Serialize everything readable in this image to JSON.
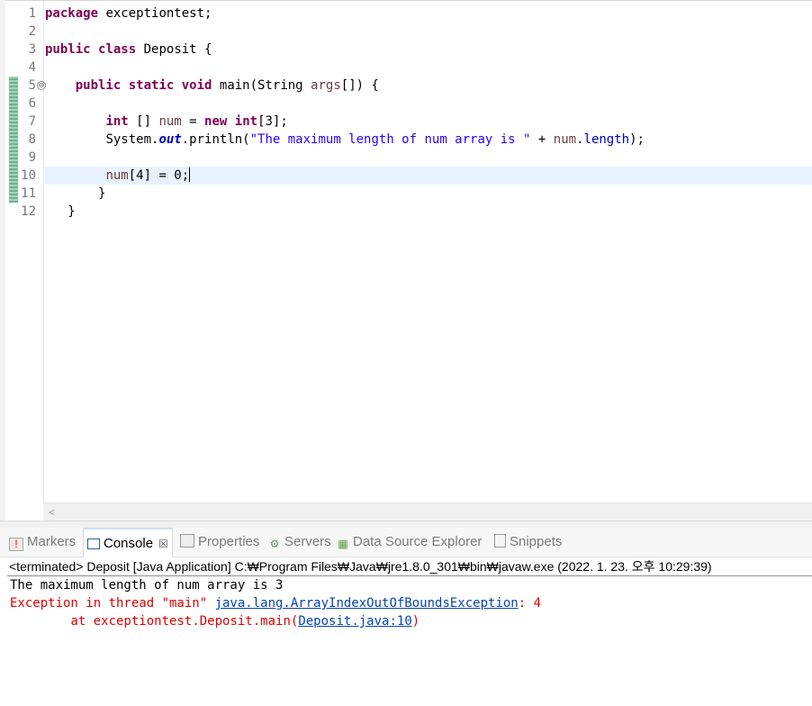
{
  "editor": {
    "line_numbers": [
      "1",
      "2",
      "3",
      "4",
      "5",
      "6",
      "7",
      "8",
      "9",
      "10",
      "11",
      "12"
    ],
    "fold_marker": "⊖",
    "scroll_left": "<",
    "code": {
      "l1_kw": "package",
      "l1_rest": " exceptiontest;",
      "l3_kw1": "public",
      "l3_kw2": "class",
      "l3_rest": " Deposit {",
      "l5_kw1": "public",
      "l5_kw2": "static",
      "l5_kw3": "void",
      "l5_a": " main(String ",
      "l5_var": "args",
      "l5_b": "[]) {",
      "l7_kw1": "int",
      "l7_a": " [] ",
      "l7_var": "num",
      "l7_b": " = ",
      "l7_kw2": "new",
      "l7_kw3": "int",
      "l7_c": "[3];",
      "l8_a": "System.",
      "l8_out": "out",
      "l8_b": ".println(",
      "l8_str": "\"The maximum length of num array is \"",
      "l8_c": " + ",
      "l8_var": "num",
      "l8_d": ".",
      "l8_fld": "length",
      "l8_e": ");",
      "l10_var": "num",
      "l10_rest": "[4] = 0;",
      "l11": "}",
      "l12": "}"
    }
  },
  "tabs": [
    {
      "label": "Markers",
      "icon": "markers-icon"
    },
    {
      "label": "Console",
      "icon": "console-icon",
      "close": "☒"
    },
    {
      "label": "Properties",
      "icon": "properties-icon"
    },
    {
      "label": "Servers",
      "icon": "servers-icon"
    },
    {
      "label": "Data Source Explorer",
      "icon": "data-source-icon"
    },
    {
      "label": "Snippets",
      "icon": "snippets-icon"
    }
  ],
  "console": {
    "status": "<terminated> Deposit [Java Application] C:₩Program Files₩Java₩jre1.8.0_301₩bin₩javaw.exe (2022. 1. 23. 오후 10:29:39)",
    "out1": "The maximum length of num array is 3",
    "err_prefix": "Exception in thread \"main\" ",
    "err_link": "java.lang.ArrayIndexOutOfBoundsException",
    "err_suffix": ": 4",
    "trace_prefix": "\tat exceptiontest.Deposit.main(",
    "trace_link": "Deposit.java:10",
    "trace_suffix": ")"
  },
  "colors": {
    "keyword": "#7f0055",
    "string": "#2a00ff",
    "local_var": "#6a3e3e",
    "field": "#0000c0",
    "error": "#e00000",
    "link": "#0645ad",
    "current_line": "#e8f2fe"
  }
}
